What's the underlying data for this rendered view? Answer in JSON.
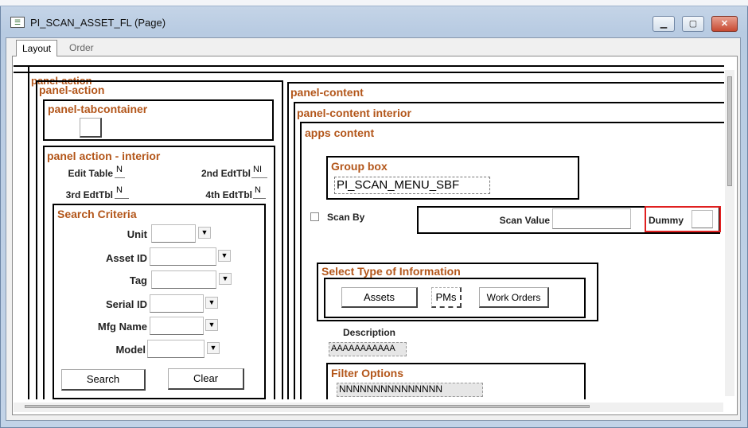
{
  "window": {
    "title": "PI_SCAN_ASSET_FL (Page)",
    "icon": "page-icon"
  },
  "tabs": [
    {
      "label": "Layout",
      "active": true
    },
    {
      "label": "Order",
      "active": false
    }
  ],
  "canvas": {
    "clipped_label": "panel-action",
    "panel_action": {
      "title": "panel-action",
      "tabcontainer": {
        "title": "panel-tabcontainer"
      },
      "interior": {
        "title": "panel action - interior",
        "edit_table": {
          "label": "Edit Table",
          "value": "N"
        },
        "edt2": {
          "label": "2nd EdtTbl",
          "value": "NI"
        },
        "edt3": {
          "label": "3rd EdtTbl",
          "value": "N"
        },
        "edt4": {
          "label": "4th EdtTbl",
          "value": "N"
        }
      },
      "search": {
        "title": "Search Criteria",
        "fields": [
          {
            "label": "Unit"
          },
          {
            "label": "Asset ID"
          },
          {
            "label": "Tag"
          },
          {
            "label": "Serial ID"
          },
          {
            "label": "Mfg Name"
          },
          {
            "label": "Model"
          }
        ],
        "search_button": "Search",
        "clear_button": "Clear"
      }
    },
    "panel_content": {
      "title": "panel-content",
      "interior_title": "panel-content interior",
      "apps_title": "apps content",
      "group_box": {
        "title": "Group box",
        "value": "PI_SCAN_MENU_SBF"
      },
      "scan_by": "Scan By",
      "scan_value": "Scan Value",
      "dummy": "Dummy",
      "select_type": {
        "title": "Select Type of Information",
        "buttons": [
          "Assets",
          "PMs",
          "Work Orders"
        ]
      },
      "description": {
        "label": "Description",
        "value": "AAAAAAAAAAA"
      },
      "filter": {
        "title": "Filter Options",
        "value": "NNNNNNNNNNNNNNN"
      }
    }
  },
  "colors": {
    "group_title": "#b3561a",
    "highlight": "#e02020"
  }
}
